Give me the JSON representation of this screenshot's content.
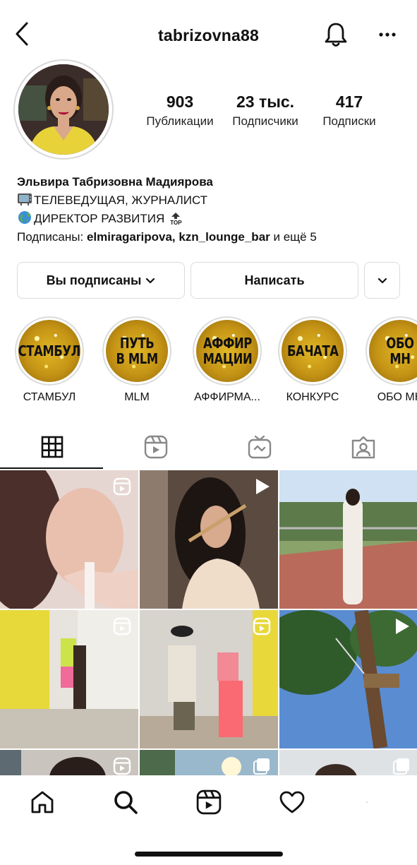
{
  "header": {
    "username": "tabrizovna88",
    "back_icon": "chevron-left-icon",
    "bell_icon": "bell-icon",
    "more_icon": "ellipsis-icon"
  },
  "profile": {
    "avatar_icon": "profile-photo",
    "stats": [
      {
        "value": "903",
        "label": "Публикации"
      },
      {
        "value": "23 тыс.",
        "label": "Подписчики"
      },
      {
        "value": "417",
        "label": "Подписки"
      }
    ],
    "full_name": "Эльвира Табризовна Мадиярова",
    "bio_line1": "ТЕЛЕВЕДУЩАЯ, ЖУРНАЛИСТ",
    "bio_line2": "ДИРЕКТОР РАЗВИТИЯ",
    "bio_badge": "TOP",
    "followed_prefix": "Подписаны:",
    "followed_users": "elmiragaripova, kzn_lounge_bar",
    "followed_suffix": "и ещё 5"
  },
  "actions": {
    "follow_label": "Вы подписаны",
    "message_label": "Написать"
  },
  "highlights": [
    {
      "cover": "СТАМБУЛ",
      "label": "СТАМБУЛ"
    },
    {
      "cover": "ПУТЬ\nВ MLM",
      "label": "MLM"
    },
    {
      "cover": "АФФИР\nМАЦИИ",
      "label": "АФФИРМА..."
    },
    {
      "cover": "БАЧАТА",
      "label": "КОНКУРС"
    },
    {
      "cover": "ОБО МН",
      "label": "ОБО МН"
    }
  ],
  "tabs": [
    {
      "icon": "grid-icon",
      "active": true
    },
    {
      "icon": "reels-icon",
      "active": false
    },
    {
      "icon": "igtv-icon",
      "active": false
    },
    {
      "icon": "tagged-icon",
      "active": false
    }
  ],
  "posts": [
    {
      "type": "reel"
    },
    {
      "type": "video"
    },
    {
      "type": "photo"
    },
    {
      "type": "reel"
    },
    {
      "type": "reel"
    },
    {
      "type": "video"
    },
    {
      "type": "reel"
    },
    {
      "type": "carousel"
    },
    {
      "type": "carousel"
    }
  ],
  "navbar": [
    "home-icon",
    "search-icon",
    "reels-icon",
    "heart-icon",
    "profile-icon"
  ],
  "colors": {
    "text": "#111111",
    "border": "#dbdbdb",
    "gold": "#d4a81c"
  }
}
